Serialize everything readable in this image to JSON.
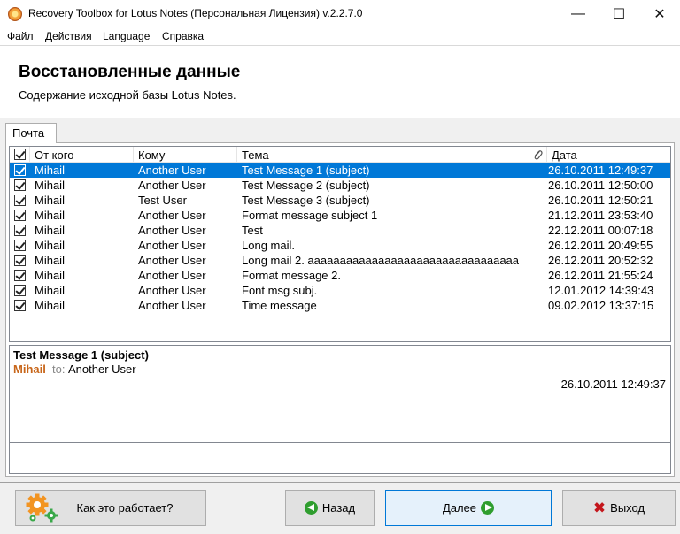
{
  "window": {
    "title": "Recovery Toolbox for Lotus Notes (Персональная Лицензия) v.2.2.7.0",
    "min_glyph": "—",
    "max_glyph": "☐",
    "close_glyph": "✕"
  },
  "menu": {
    "items": [
      {
        "label": "Файл"
      },
      {
        "label": "Действия"
      },
      {
        "label": "Language"
      },
      {
        "label": "Справка"
      }
    ]
  },
  "header": {
    "title": "Восстановленные данные",
    "subtitle": "Содержание исходной базы Lotus Notes."
  },
  "tabs": [
    {
      "label": "Почта",
      "active": true
    }
  ],
  "table": {
    "columns": {
      "from": "От кого",
      "to": "Кому",
      "subject": "Тема",
      "date": "Дата"
    },
    "rows": [
      {
        "checked": true,
        "from": "Mihail",
        "to": "Another User",
        "subject": "Test Message 1 (subject)",
        "date": "26.10.2011 12:49:37",
        "selected": true
      },
      {
        "checked": true,
        "from": "Mihail",
        "to": "Another User",
        "subject": "Test Message 2 (subject)",
        "date": "26.10.2011 12:50:00"
      },
      {
        "checked": true,
        "from": "Mihail",
        "to": "Test User",
        "subject": "Test Message 3 (subject)",
        "date": "26.10.2011 12:50:21"
      },
      {
        "checked": true,
        "from": "Mihail",
        "to": "Another User",
        "subject": "Format message subject 1",
        "date": "21.12.2011 23:53:40"
      },
      {
        "checked": true,
        "from": "Mihail",
        "to": "Another User",
        "subject": "Test",
        "date": "22.12.2011 00:07:18"
      },
      {
        "checked": true,
        "from": "Mihail",
        "to": "Another User",
        "subject": "Long mail.",
        "date": "26.12.2011 20:49:55"
      },
      {
        "checked": true,
        "from": "Mihail",
        "to": "Another User",
        "subject": "Long mail 2. aaaaaaaaaaaaaaaaaaaaaaaaaaaaaaaaa",
        "date": "26.12.2011 20:52:32"
      },
      {
        "checked": true,
        "from": "Mihail",
        "to": "Another User",
        "subject": "Format message 2.",
        "date": "26.12.2011 21:55:24"
      },
      {
        "checked": true,
        "from": "Mihail",
        "to": "Another User",
        "subject": "Font msg subj.",
        "date": "12.01.2012 14:39:43"
      },
      {
        "checked": true,
        "from": "Mihail",
        "to": "Another User",
        "subject": "Time message",
        "date": "09.02.2012 13:37:15"
      }
    ]
  },
  "preview": {
    "subject": "Test Message 1 (subject)",
    "from": "Mihail",
    "to_label": "to:",
    "to": "Another User",
    "date": "26.10.2011 12:49:37"
  },
  "buttons": {
    "how": "Как это работает?",
    "back": "Назад",
    "next": "Далее",
    "exit": "Выход"
  },
  "icons": {
    "app": "lotus-notes-app-icon",
    "gears": "gears-icon",
    "back": "green-left-arrow-icon",
    "next": "green-right-arrow-icon",
    "exit": "red-x-icon",
    "attachment": "paperclip-icon"
  },
  "colors": {
    "selection": "#0078d7",
    "sender": "#c8661a",
    "primary_button_border": "#0078d7"
  }
}
